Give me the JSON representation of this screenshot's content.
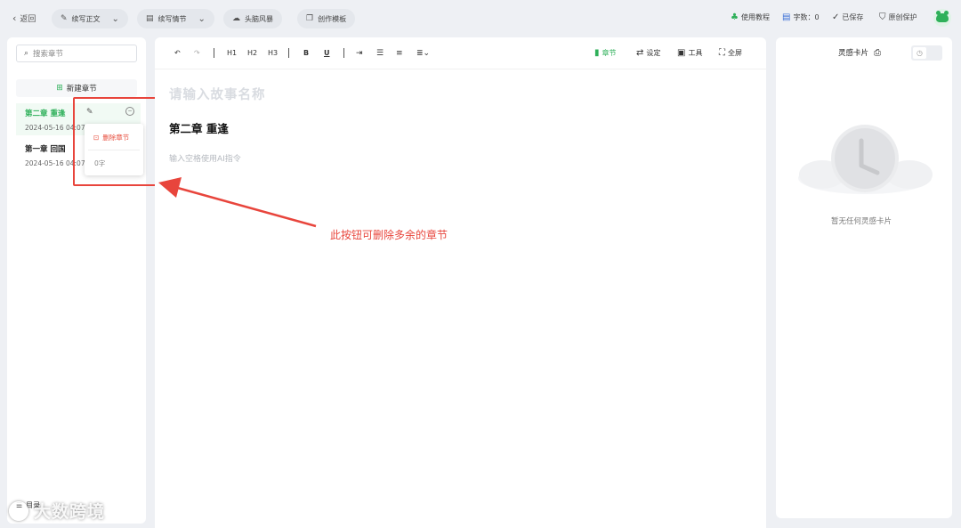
{
  "topbar": {
    "back_label": "返回",
    "continue_text_label": "续写正文",
    "continue_plot_label": "续写情节",
    "brainstorm_label": "头脑风暴",
    "template_label": "创作模板",
    "tutorial_label": "使用教程",
    "word_count_label": "字数：0",
    "saved_label": "已保存",
    "protection_label": "原创保护"
  },
  "sidebar": {
    "search_placeholder": "搜索章节",
    "new_chapter_label": "新建章节",
    "chapters": [
      {
        "title": "第二章 重逢",
        "date": "2024-05-16 04:07",
        "active": true
      },
      {
        "title": "第一章 回国",
        "date": "2024-05-16 04:07",
        "active": false
      }
    ],
    "bottom_label": "目录"
  },
  "popover": {
    "delete_label": "删除章节",
    "word_count": "0字"
  },
  "toolbar": {
    "h1": "H1",
    "h2": "H2",
    "h3": "H3",
    "bold": "B",
    "underline": "U",
    "chapter_label": "章节",
    "settings_label": "设定",
    "tools_label": "工具",
    "fullscreen_label": "全屏"
  },
  "editor": {
    "title_placeholder": "请输入故事名称",
    "chapter_heading": "第二章 重逢",
    "ai_placeholder": "输入空格使用AI指令"
  },
  "annotation": {
    "text": "此按钮可删除多余的章节",
    "color": "#e8453c"
  },
  "inspiration": {
    "title": "灵感卡片",
    "empty_text": "暂无任何灵感卡片"
  },
  "watermark": {
    "text": "大数跨境"
  },
  "colors": {
    "accent": "#2fb05a",
    "danger": "#e74c3c",
    "background": "#eef0f4"
  }
}
